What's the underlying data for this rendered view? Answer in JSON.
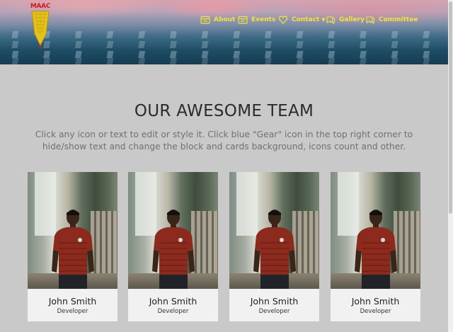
{
  "header": {
    "logo_text": "MAAC",
    "nav": [
      {
        "label": "About",
        "icon": "calendar-icon"
      },
      {
        "label": "Events",
        "icon": "calendar-icon"
      },
      {
        "label": "Contact",
        "icon": "heart-icon",
        "has_dropdown": true
      },
      {
        "label": "Gallery",
        "icon": "chat-icon"
      },
      {
        "label": "Committee",
        "icon": "chat-icon"
      }
    ],
    "nav_color": "#f1e339"
  },
  "team": {
    "title": "OUR AWESOME TEAM",
    "description": "Click any icon or text to edit or style it. Click blue \"Gear\" icon in the top right corner to hide/show text and change the block and cards background, icons count and other.",
    "cards": [
      {
        "name": "John Smith",
        "role": "Developer"
      },
      {
        "name": "John Smith",
        "role": "Developer"
      },
      {
        "name": "John Smith",
        "role": "Developer"
      },
      {
        "name": "John Smith",
        "role": "Developer"
      }
    ]
  }
}
